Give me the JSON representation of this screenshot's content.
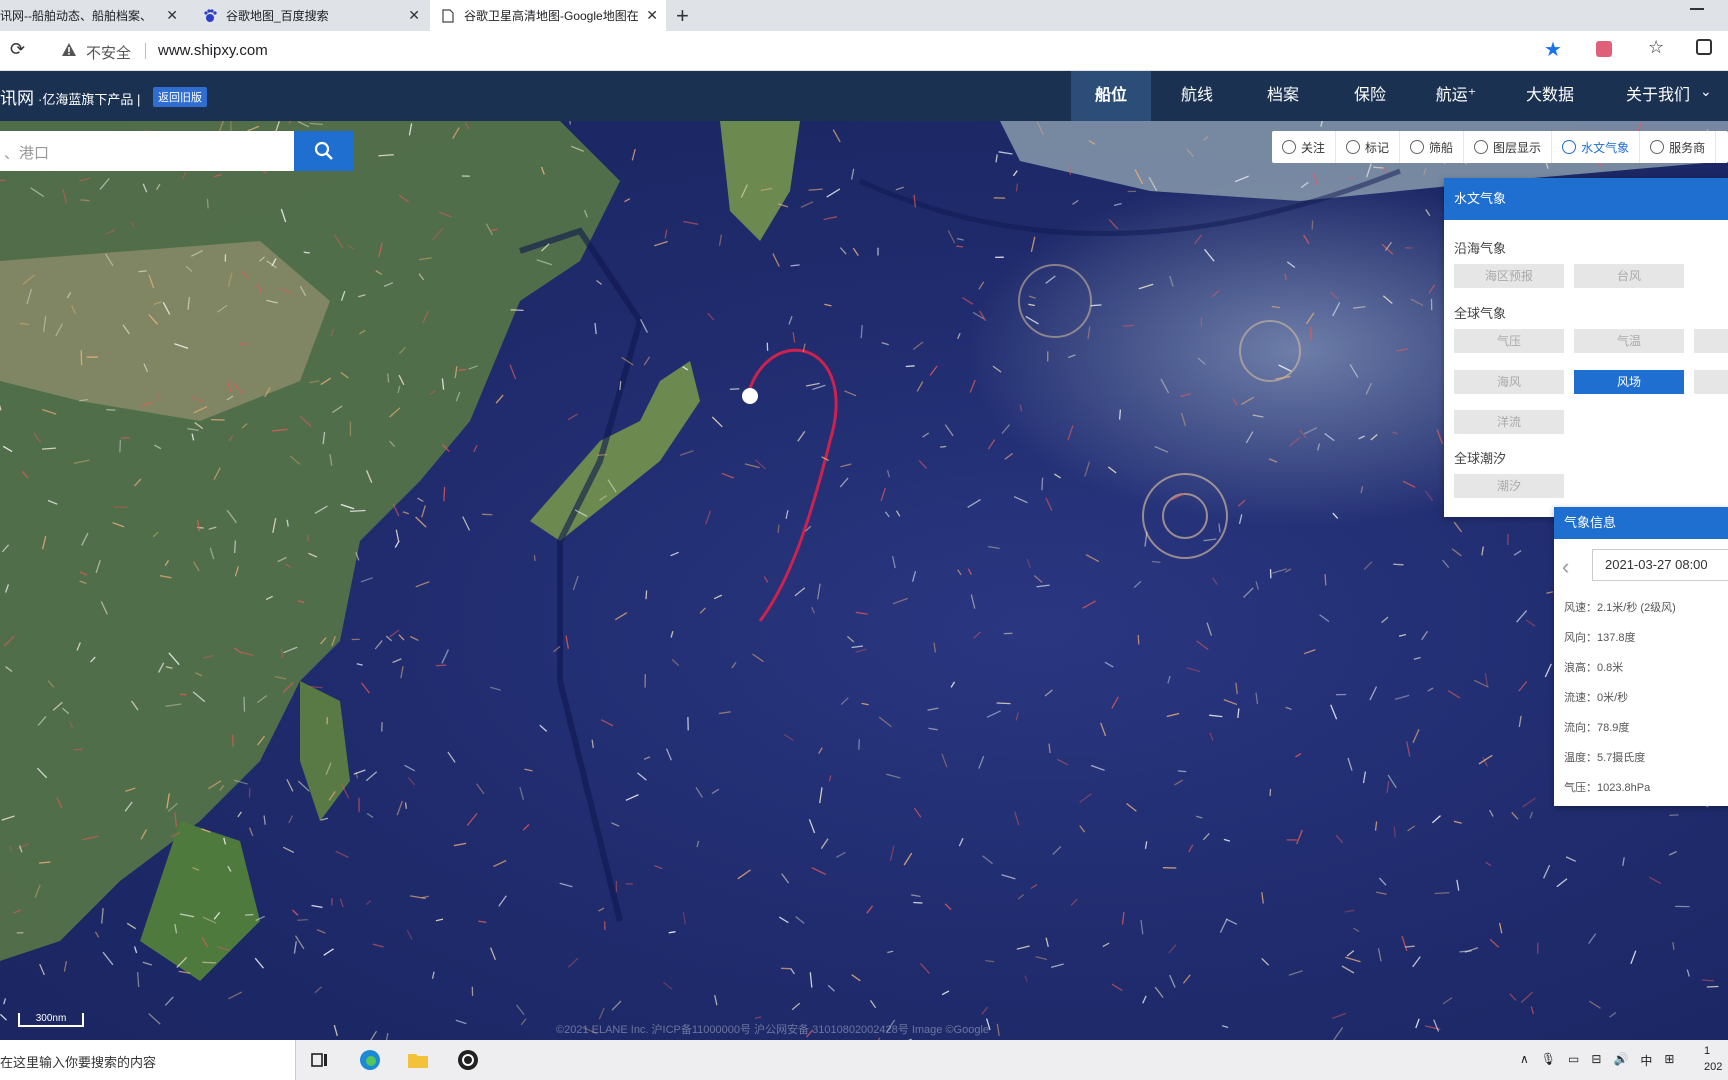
{
  "browser": {
    "tabs": [
      {
        "title": "讯网--船舶动态、船舶档案、A"
      },
      {
        "title": "谷歌地图_百度搜索"
      },
      {
        "title": "谷歌卫星高清地图-Google地图在"
      }
    ],
    "insecure_label": "不安全",
    "url": "www.shipxy.com"
  },
  "site": {
    "logo": "讯网",
    "tagline": "·亿海蓝旗下产品 |",
    "old_version": "返回旧版",
    "nav": [
      "船位",
      "航线",
      "档案",
      "保险",
      "航运⁺",
      "大数据",
      "关于我们"
    ],
    "active_nav": "船位"
  },
  "search": {
    "placeholder": "、港口"
  },
  "map_toolbar": [
    "关注",
    "标记",
    "筛船",
    "图层显示",
    "水文气象",
    "服务商"
  ],
  "hydro_panel": {
    "title": "水文气象",
    "coastal": "沿海气象",
    "coastal_buttons": [
      "海区预报",
      "台风"
    ],
    "global": "全球气象",
    "global_buttons": [
      "气压",
      "气温",
      "海风",
      "风场",
      "洋流"
    ],
    "active": "风场",
    "tide": "全球潮汐",
    "tide_buttons": [
      "潮汐"
    ]
  },
  "meteo_panel": {
    "title": "气象信息",
    "datetime": "2021-03-27 08:00",
    "rows": [
      "风速：2.1米/秒 (2级风)",
      "风向：137.8度",
      "浪高：0.8米",
      "流速：0米/秒",
      "流向：78.9度",
      "温度：5.7摄氏度",
      "气压：1023.8hPa"
    ]
  },
  "map": {
    "scale": "300nm",
    "copyright": "©2021 ELANE Inc.  沪ICP备11000000号  沪公网安备 31010802002428号  Image ©Google"
  },
  "taskbar": {
    "search_text": "在这里输入你要搜索的内容",
    "ime": "中",
    "clock_time": "1",
    "clock_date": "202"
  }
}
